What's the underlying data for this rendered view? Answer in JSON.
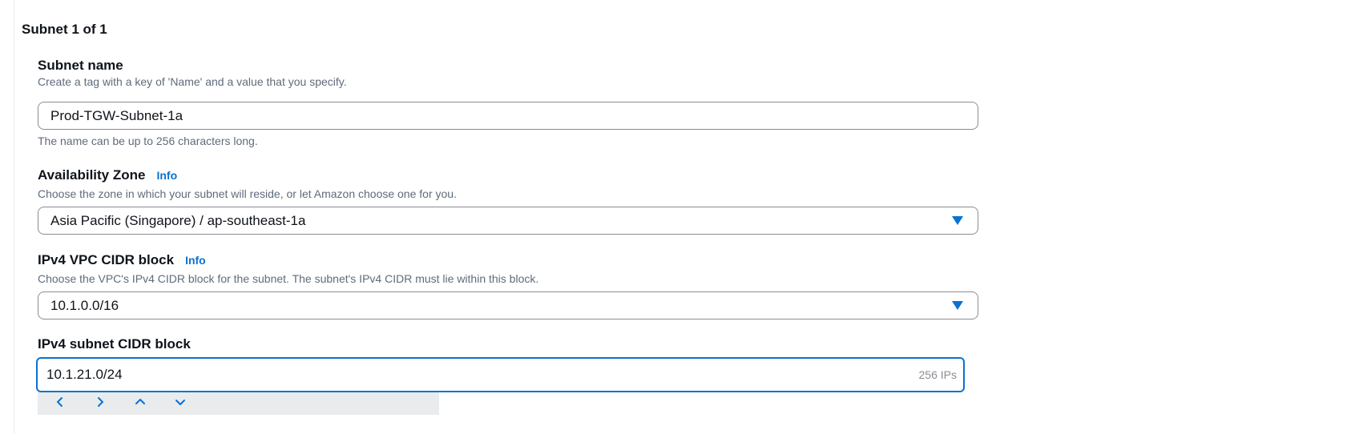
{
  "section": {
    "title": "Subnet 1 of 1"
  },
  "subnet_name": {
    "label": "Subnet name",
    "description": "Create a tag with a key of 'Name' and a value that you specify.",
    "value": "Prod-TGW-Subnet-1a",
    "hint": "The name can be up to 256 characters long."
  },
  "availability_zone": {
    "label": "Availability Zone",
    "info": "Info",
    "description": "Choose the zone in which your subnet will reside, or let Amazon choose one for you.",
    "value": "Asia Pacific (Singapore) / ap-southeast-1a"
  },
  "vpc_cidr": {
    "label": "IPv4 VPC CIDR block",
    "info": "Info",
    "description": "Choose the VPC's IPv4 CIDR block for the subnet. The subnet's IPv4 CIDR must lie within this block.",
    "value": "10.1.0.0/16"
  },
  "subnet_cidr": {
    "label": "IPv4 subnet CIDR block",
    "value": "10.1.21.0/24",
    "ip_count": "256 IPs"
  },
  "stepper": {
    "icons": [
      "chevron-left-icon",
      "chevron-right-icon",
      "chevron-up-icon",
      "chevron-down-icon"
    ]
  },
  "colors": {
    "accent": "#0972d3",
    "text": "#0f141a",
    "secondary_text": "#5f6b7a",
    "border": "#8c8c94"
  }
}
